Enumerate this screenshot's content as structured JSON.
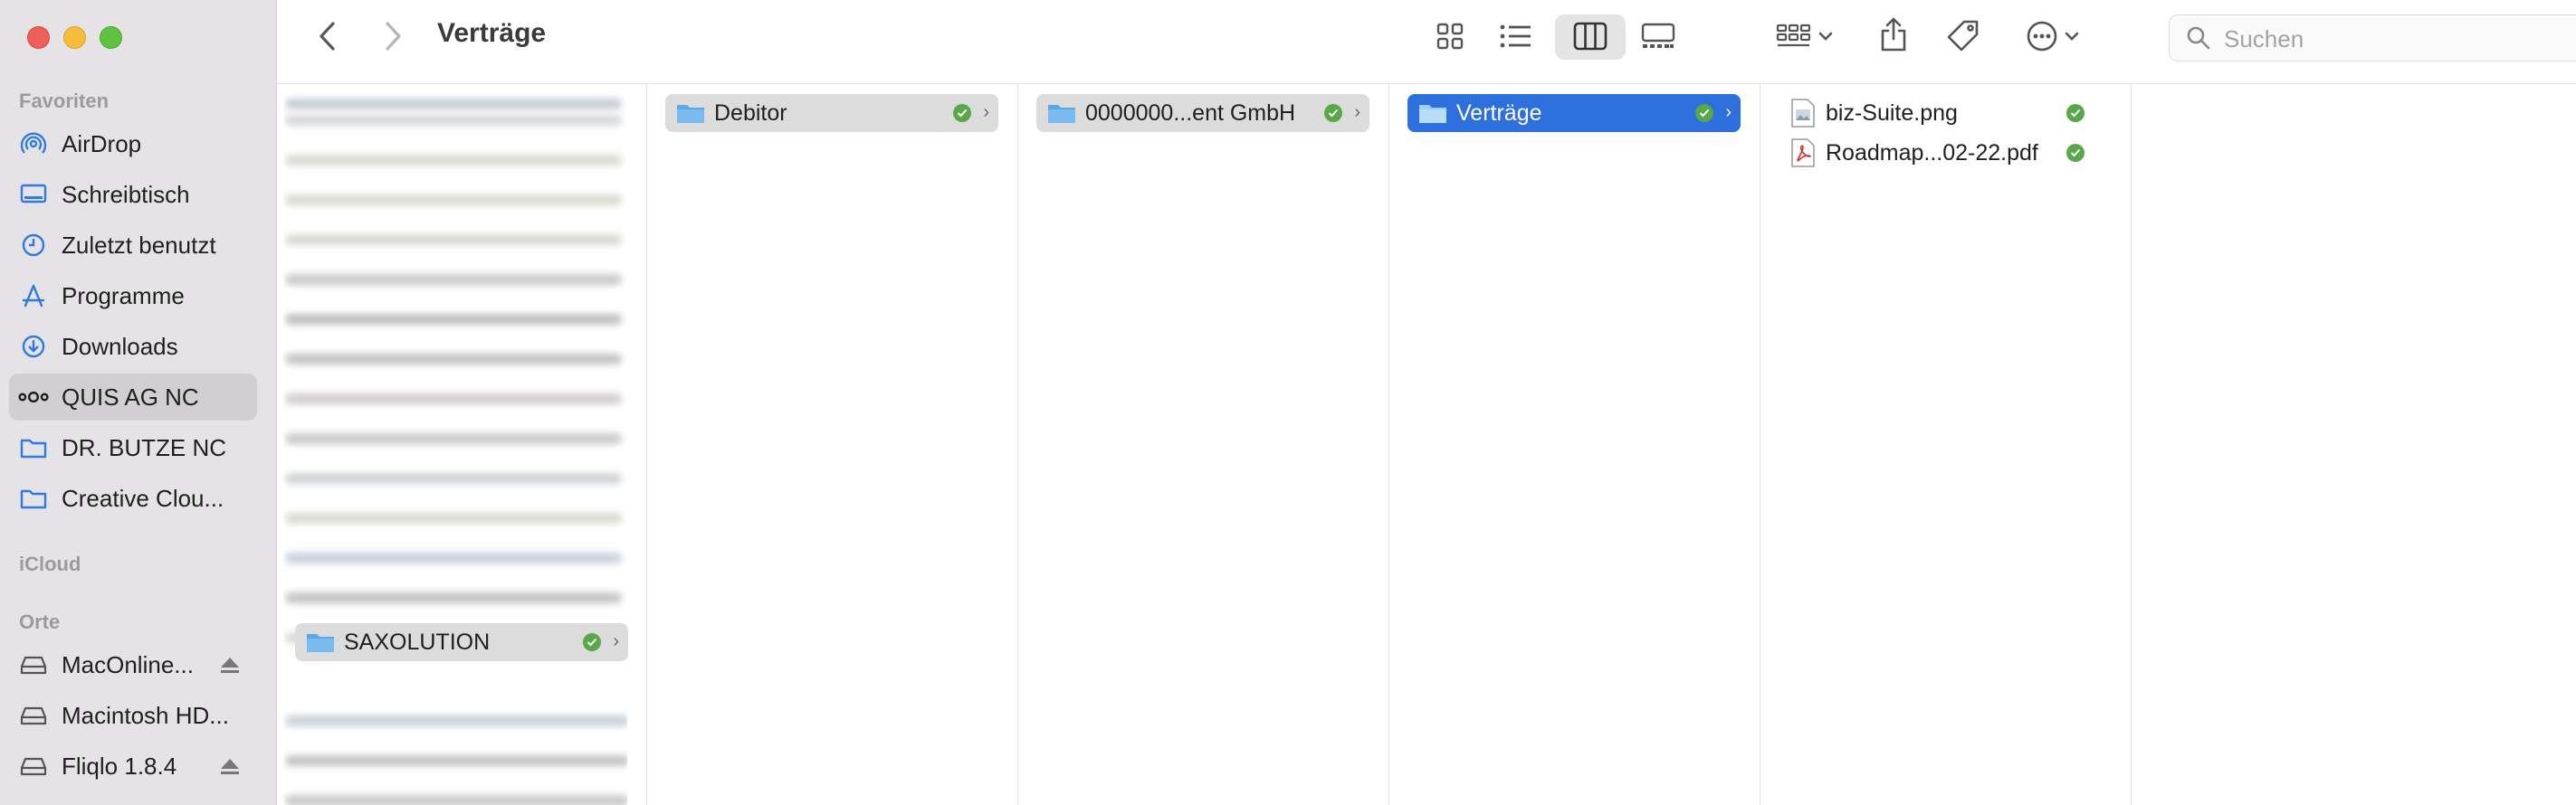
{
  "window": {
    "title": "Verträge"
  },
  "sidebar": {
    "sections": [
      {
        "title": "Favoriten"
      },
      {
        "title": "iCloud"
      },
      {
        "title": "Orte"
      }
    ],
    "favorites": [
      {
        "label": "AirDrop",
        "icon": "airdrop-icon"
      },
      {
        "label": "Schreibtisch",
        "icon": "desktop-icon"
      },
      {
        "label": "Zuletzt benutzt",
        "icon": "clock-icon"
      },
      {
        "label": "Programme",
        "icon": "apps-icon"
      },
      {
        "label": "Downloads",
        "icon": "download-icon"
      },
      {
        "label": "QUIS AG NC",
        "icon": "nextcloud-icon"
      },
      {
        "label": "DR. BUTZE NC",
        "icon": "folder-icon"
      },
      {
        "label": "Creative Clou...",
        "icon": "folder-icon"
      }
    ],
    "locations": [
      {
        "label": "MacOnline...",
        "icon": "drive-icon"
      },
      {
        "label": "Macintosh HD...",
        "icon": "drive-icon"
      },
      {
        "label": "Fliqlo 1.8.4",
        "icon": "drive-icon"
      }
    ]
  },
  "toolbar": {
    "back": "back-icon",
    "forward": "forward-icon",
    "views": [
      "icon-view-icon",
      "list-view-icon",
      "column-view-icon",
      "gallery-view-icon"
    ],
    "search_placeholder": "Suchen"
  },
  "columns": {
    "col1": {
      "selected": "SAXOLUTION"
    },
    "col2": {
      "items": [
        "Debitor"
      ]
    },
    "col3": {
      "items": [
        "0000000...ent GmbH"
      ]
    },
    "col4": {
      "items": [
        "Verträge"
      ]
    },
    "col5": {
      "items": [
        {
          "label": "biz-Suite.png",
          "icon": "image-file-icon"
        },
        {
          "label": "Roadmap...02-22.pdf",
          "icon": "pdf-file-icon"
        }
      ]
    }
  },
  "colors": {
    "accent": "#2d6fdc",
    "sync_ok": "#58a84a",
    "folder": "#5aa9e6"
  }
}
